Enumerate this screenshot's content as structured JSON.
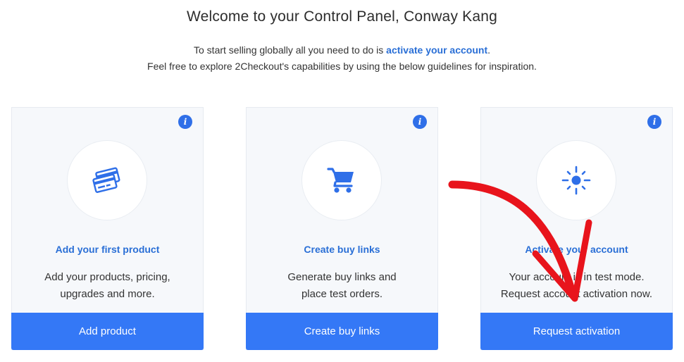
{
  "header": {
    "title": "Welcome to your Control Panel, Conway Kang",
    "line1_prefix": "To start selling globally all you need to do is ",
    "line1_link": "activate your account",
    "line1_suffix": ".",
    "line2": "Feel free to explore 2Checkout's capabilities by using the below guidelines for inspiration."
  },
  "cards": [
    {
      "icon": "credit-cards-icon",
      "title": "Add your first product",
      "desc_line1": "Add your products, pricing,",
      "desc_line2": "upgrades and more.",
      "button": "Add product"
    },
    {
      "icon": "shopping-cart-icon",
      "title": "Create buy links",
      "desc_line1": "Generate buy links and",
      "desc_line2": "place test orders.",
      "button": "Create buy links"
    },
    {
      "icon": "activation-icon",
      "title": "Activate your account",
      "desc_line1": "Your account is in test mode.",
      "desc_line2": "Request account activation now.",
      "button": "Request activation"
    }
  ],
  "info_glyph": "i",
  "colors": {
    "accent": "#3478f6",
    "link": "#2a6fd6",
    "annotation_arrow": "#e8141c"
  }
}
